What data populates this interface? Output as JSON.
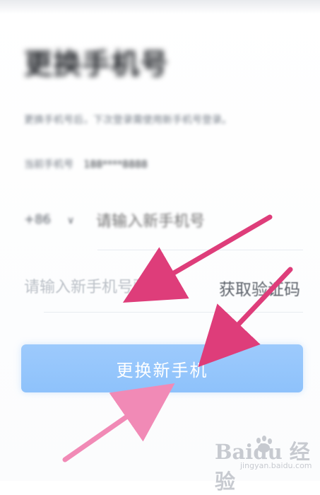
{
  "screen": {
    "title": "更换手机号",
    "description": "更换手机号后，下次登录需使用新手机号登录。",
    "current_phone": {
      "label": "当前手机号",
      "value": "188****8888"
    },
    "country_code": "+86",
    "country_arrow": "∨",
    "new_phone_placeholder": "请输入新手机号",
    "code_placeholder": "请输入新手机号验证码",
    "get_code_label": "获取验证码",
    "submit_label": "更换新手机"
  },
  "watermark": {
    "logo": "Baidu 经验",
    "url": "jingyan.baidu.com"
  },
  "colors": {
    "button": "#8fc3fb",
    "arrow": "#de3d7a",
    "arrow_light": "#f18ab6",
    "placeholder": "#bcc1c8"
  }
}
